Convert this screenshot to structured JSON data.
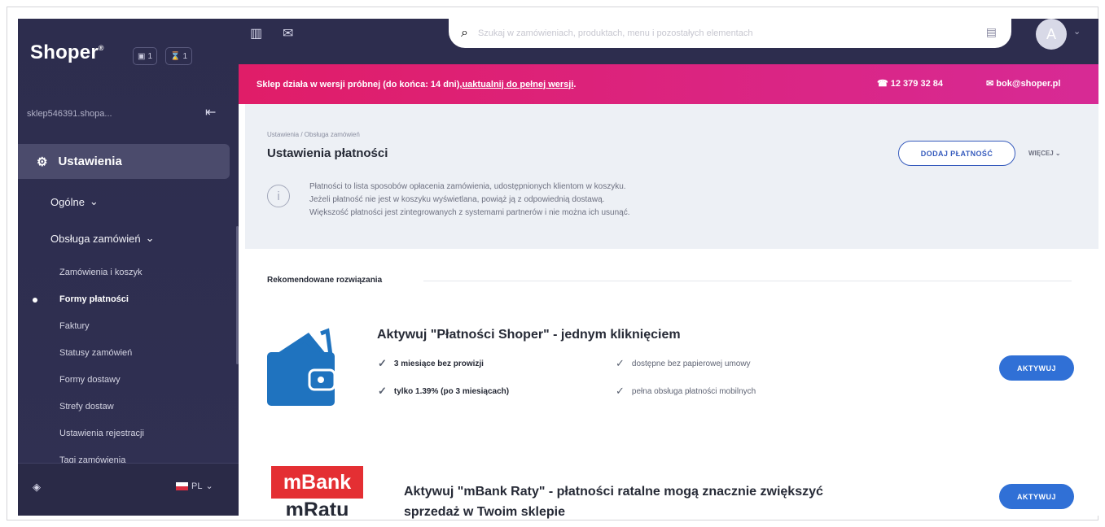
{
  "sidebar": {
    "brand": "Shoper",
    "brand_mark": "®",
    "mini_badges": [
      {
        "icon": "document-icon",
        "count": "1"
      },
      {
        "icon": "hourglass-icon",
        "count": "1"
      }
    ],
    "store_name": "sklep546391.shopa...",
    "active_section": "Ustawienia",
    "menu": [
      {
        "label": "Ogólne"
      },
      {
        "label": "Obsługa zamówień"
      }
    ],
    "sub_items": [
      {
        "label": "Zamówienia i koszyk"
      },
      {
        "label": "Formy płatności"
      },
      {
        "label": "Faktury"
      },
      {
        "label": "Statusy zamówień"
      },
      {
        "label": "Formy dostawy"
      },
      {
        "label": "Strefy dostaw"
      },
      {
        "label": "Ustawienia rejestracji"
      },
      {
        "label": "Tagi zamówienia"
      }
    ],
    "language": "PL"
  },
  "topbar": {
    "search": {
      "placeholder": "Szukaj w zamówieniach, produktach, menu i pozostałych elementach"
    },
    "avatar": "A"
  },
  "trial": {
    "message": "Sklep działa w wersji próbnej (do końca: 14 dni), ",
    "link": "uaktualnij do pełnej wersji",
    "suffix": ".",
    "phone": "12 379 32 84",
    "email": "bok@shoper.pl"
  },
  "settings": {
    "breadcrumb": "Ustawienia  /  Obsługa zamówień",
    "title": "Ustawienia płatności",
    "add_payment": "DODAJ PŁATNOŚĆ",
    "more": "WIĘCEJ",
    "info_lines": [
      "Płatności to lista sposobów opłacenia zamówienia, udostępnionych klientom w koszyku.",
      "Jeżeli płatność nie jest w koszyku wyświetlana, powiąż ją z odpowiednią dostawą.",
      "Większość płatności jest zintegrowanych z systemami partnerów i nie można ich usunąć."
    ]
  },
  "recommended": {
    "title": "Rekomendowane rozwiązania",
    "offers": [
      {
        "title": "Aktywuj \"Płatności Shoper\" - jednym kliknięciem",
        "features": [
          "3 miesiące bez prowizji",
          "dostępne bez papierowej umowy",
          "tylko 1.39% (po 3 miesiącach)",
          "pełna obsługa płatności mobilnych"
        ],
        "button": "AKTYWUJ"
      },
      {
        "logo_top": "mBank",
        "logo_bottom": "mRatu",
        "title": "Aktywuj \"mBank Raty\" - płatności ratalne mogą znacznie zwiększyć sprzedaż w Twoim sklepie",
        "button": "AKTYWUJ"
      }
    ]
  },
  "colors": {
    "sidebar": "#2d2d4e",
    "trial_start": "#e01d68",
    "trial_end": "#d72a95",
    "accent": "#3070d6",
    "mbank": "#e42f33"
  }
}
